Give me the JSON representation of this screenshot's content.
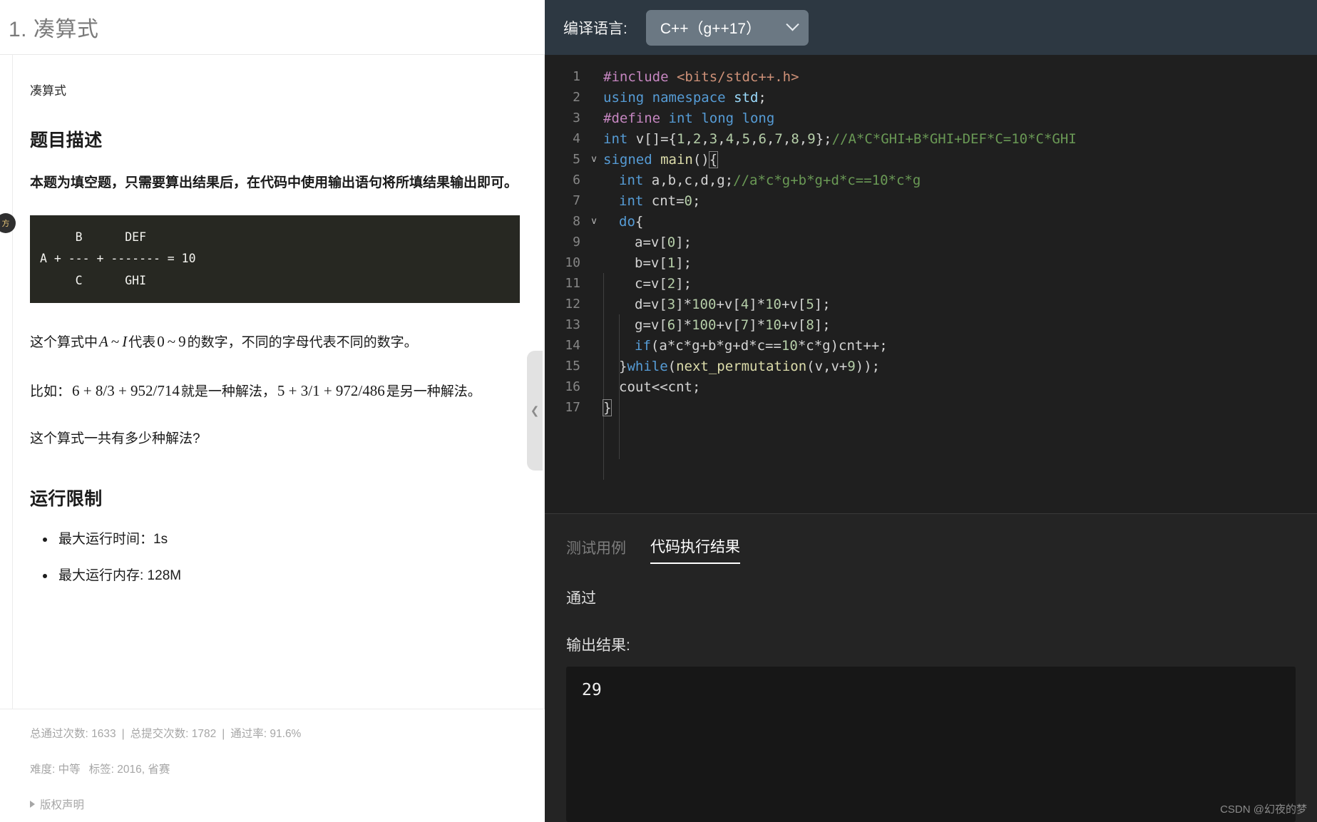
{
  "problem": {
    "title": "1. 凑算式",
    "subtitle": "凑算式",
    "section_description_heading": "题目描述",
    "description_bold": "本题为填空题，只需要算出结果后，在代码中使用输出语句将所填结果输出即可。",
    "formula_block": "     B      DEF\nA + --- + ------- = 10\n     C      GHI",
    "paragraph_letters_pre": "这个算式中",
    "paragraph_letters_a": "A",
    "paragraph_letters_tilde1": "~",
    "paragraph_letters_i": "I",
    "paragraph_letters_mid": "代表",
    "paragraph_letters_0": "0",
    "paragraph_letters_tilde2": "~",
    "paragraph_letters_9": "9",
    "paragraph_letters_post": "的数字，不同的字母代表不同的数字。",
    "example_pre": "比如：",
    "example_expr1": "6 + 8/3 + 952/714",
    "example_mid": "就是一种解法，",
    "example_expr2": "5 + 3/1 + 972/486",
    "example_post": "是另一种解法。",
    "question": "这个算式一共有多少种解法?",
    "section_limits_heading": "运行限制",
    "limits": [
      "最大运行时间：1s",
      "最大运行内存: 128M"
    ],
    "badge_label": "方",
    "stats": {
      "pass_count_label": "总通过次数: 1633",
      "submit_count_label": "总提交次数: 1782",
      "pass_rate_label": "通过率: 91.6%",
      "separator": "|"
    },
    "meta": {
      "difficulty": "难度: 中等",
      "tags": "标签: 2016, 省赛"
    },
    "copyright_label": "版权声明"
  },
  "editor": {
    "language_label": "编译语言:",
    "language_value": "C++（g++17）",
    "chevron_icon": "chevron-down-icon",
    "lines": [
      {
        "n": "1",
        "fold": ""
      },
      {
        "n": "2",
        "fold": ""
      },
      {
        "n": "3",
        "fold": ""
      },
      {
        "n": "4",
        "fold": ""
      },
      {
        "n": "5",
        "fold": "v"
      },
      {
        "n": "6",
        "fold": ""
      },
      {
        "n": "7",
        "fold": ""
      },
      {
        "n": "8",
        "fold": "v"
      },
      {
        "n": "9",
        "fold": ""
      },
      {
        "n": "10",
        "fold": ""
      },
      {
        "n": "11",
        "fold": ""
      },
      {
        "n": "12",
        "fold": ""
      },
      {
        "n": "13",
        "fold": ""
      },
      {
        "n": "14",
        "fold": ""
      },
      {
        "n": "15",
        "fold": ""
      },
      {
        "n": "16",
        "fold": ""
      },
      {
        "n": "17",
        "fold": ""
      }
    ],
    "code_text": [
      "#include <bits/stdc++.h>",
      "using namespace std;",
      "#define int long long",
      "int v[]={1,2,3,4,5,6,7,8,9};//A*C*GHI+B*GHI+DEF*C=10*C*GHI",
      "signed main(){",
      "  int a,b,c,d,g;//a*c*g+b*g+d*c==10*c*g",
      "  int cnt=0;",
      "  do{",
      "    a=v[0];",
      "    b=v[1];",
      "    c=v[2];",
      "    d=v[3]*100+v[4]*10+v[5];",
      "    g=v[6]*100+v[7]*10+v[8];",
      "    if(a*c*g+b*g+d*c==10*c*g)cnt++;",
      "  }while(next_permutation(v,v+9));",
      "  cout<<cnt;",
      "}"
    ]
  },
  "results": {
    "tabs": [
      {
        "label": "测试用例",
        "active": false
      },
      {
        "label": "代码执行结果",
        "active": true
      }
    ],
    "status": "通过",
    "output_label": "输出结果:",
    "output_value": "29"
  },
  "watermark": "CSDN @幻夜的梦",
  "colors": {
    "header_bg": "#2d3842",
    "select_bg": "#6b7883",
    "editor_bg": "#1f1f1f",
    "results_bg": "#242424",
    "output_bg": "#171717",
    "keyword": "#569cd6",
    "preprocessor": "#c586c0",
    "string": "#ce9178",
    "function": "#dcdcaa",
    "number": "#b5cea8",
    "comment": "#6a9955",
    "identifier": "#9cdcfe"
  }
}
